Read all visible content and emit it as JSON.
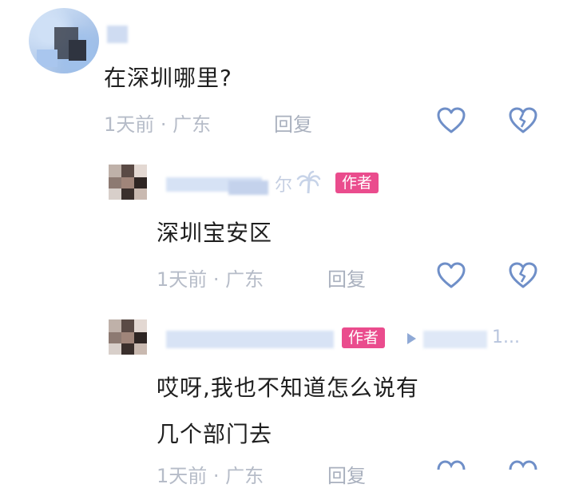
{
  "comment": {
    "text": "在深圳哪里?",
    "time_location": "1天前 · 广东",
    "reply_label": "回复"
  },
  "reply1": {
    "badge": "作者",
    "name_fragment": "尔",
    "text": "深圳宝安区",
    "time_location": "1天前 · 广东",
    "reply_label": "回复"
  },
  "reply2": {
    "badge": "作者",
    "target_fragment": "1...",
    "text_line1": "哎呀,我也不知道怎么说有",
    "text_line2": "几个部门去",
    "time_location": "1天前 · 广东",
    "reply_label": "回复"
  },
  "icons": {
    "like": "heart-outline-icon",
    "dislike": "broken-heart-icon",
    "reply_arrow": "triangle-right-icon"
  },
  "colors": {
    "text": "#1f1f1f",
    "meta": "#b6bcc8",
    "icon_blue": "#6f8fc8",
    "badge_pink": "#ea4c8d"
  }
}
